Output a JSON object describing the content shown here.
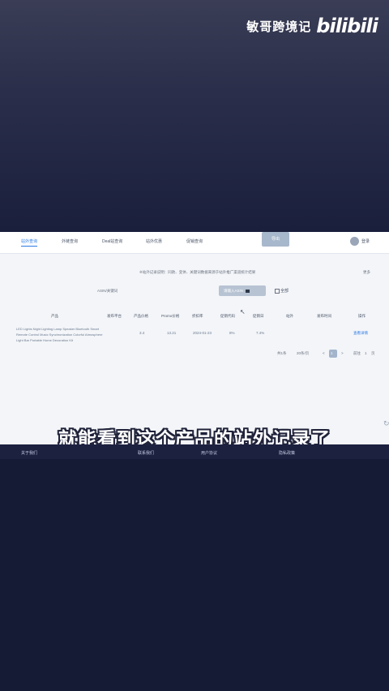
{
  "watermark": {
    "text": "敏哥跨境记",
    "logo": "bilibili"
  },
  "nav": {
    "tabs": [
      "站外查询",
      "外链查询",
      "Deal站查询",
      "站外优惠",
      "促销查询"
    ],
    "button": "导出",
    "user": "登录"
  },
  "notice": {
    "text": "※站外记录说明：同款、变体、关键词数据来源于站外推广渠道统计结果",
    "right": "更多"
  },
  "filter": {
    "label": "ASIN/关键词",
    "search_text": "请输入ASIN",
    "checkbox_label": "全部"
  },
  "table": {
    "headers": [
      "产品",
      "发布平台",
      "产品价格",
      "Promo价格",
      "折扣率",
      "促销代码",
      "促销日",
      "站外",
      "发布时间",
      "操作"
    ],
    "row": {
      "title": "LED Lights Night Lighting Lamp Speaker Bluetooth Smart Remote Control Music Synchronization Colorful Atmosphere Light Bar Portable Home Decoration Kit",
      "platform": "3.4",
      "price": "13.21",
      "promo": "2024-01-23",
      "discount": "8%",
      "code": "7.4%",
      "action": "查看详情"
    }
  },
  "pagination": {
    "total": "共1条",
    "per_page": "20条/页",
    "prev": "<",
    "page": "1",
    "next": ">",
    "goto": "前往",
    "goto_page": "1",
    "page_suffix": "页"
  },
  "subtitle": "就能看到这个产品的站外记录了",
  "footer": [
    "关于我们",
    "联系我们",
    "用户协议",
    "隐私政策"
  ]
}
